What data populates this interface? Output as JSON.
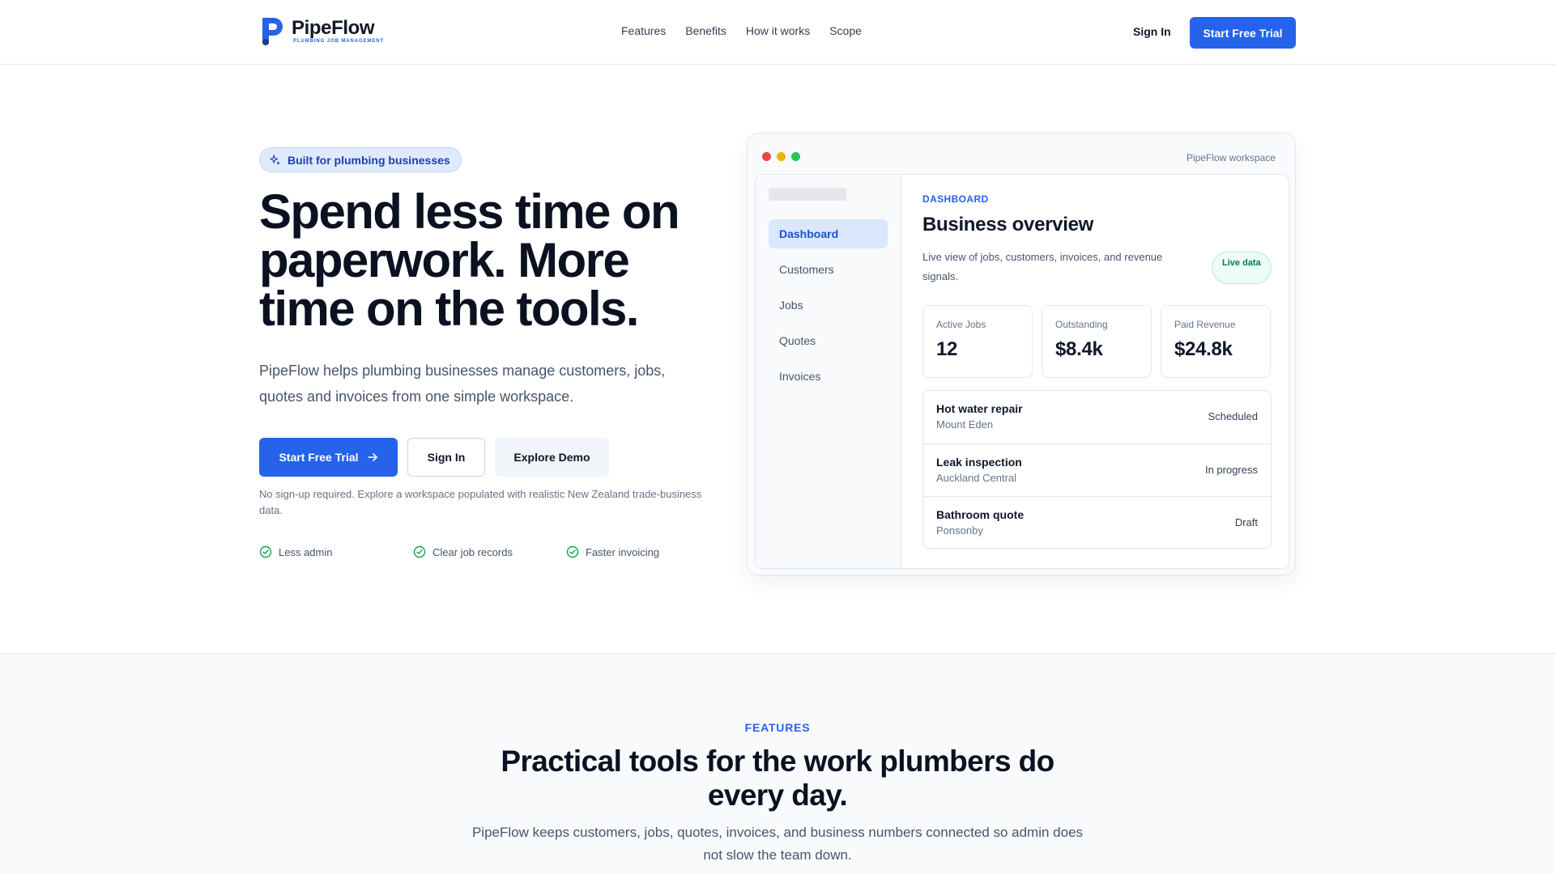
{
  "brand": {
    "name": "PipeFlow",
    "tagline": "PLUMBING JOB MANAGEMENT",
    "accent": "#2563eb"
  },
  "nav": [
    "Features",
    "Benefits",
    "How it works",
    "Scope"
  ],
  "header": {
    "signin_label": "Sign In",
    "trial_label": "Start Free Trial"
  },
  "hero": {
    "badge": "Built for plumbing businesses",
    "title": "Spend less time on paperwork. More time on the tools.",
    "subtitle": "PipeFlow helps plumbing businesses manage customers, jobs, quotes and invoices from one simple workspace.",
    "primary_cta": "Start Free Trial",
    "secondary_cta": "Sign In",
    "tertiary_cta": "Explore Demo",
    "hint": "No sign-up required. Explore a workspace populated with realistic New Zealand trade-business data.",
    "checks": [
      "Less admin",
      "Clear job records",
      "Faster invoicing"
    ]
  },
  "mockup": {
    "window_title": "PipeFlow workspace",
    "sidebar": [
      "Dashboard",
      "Customers",
      "Jobs",
      "Quotes",
      "Invoices"
    ],
    "active_item": "Dashboard",
    "section_label": "DASHBOARD",
    "title": "Business overview",
    "description": "Live view of jobs, customers, invoices, and revenue signals.",
    "live_badge": "Live data",
    "stats": [
      {
        "label": "Active Jobs",
        "value": "12"
      },
      {
        "label": "Outstanding",
        "value": "$8.4k"
      },
      {
        "label": "Paid Revenue",
        "value": "$24.8k"
      }
    ],
    "jobs": [
      {
        "name": "Hot water repair",
        "location": "Mount Eden",
        "status": "Scheduled"
      },
      {
        "name": "Leak inspection",
        "location": "Auckland Central",
        "status": "In progress"
      },
      {
        "name": "Bathroom quote",
        "location": "Ponsonby",
        "status": "Draft"
      }
    ]
  },
  "features": {
    "label": "FEATURES",
    "title": "Practical tools for the work plumbers do every day.",
    "subtitle": "PipeFlow keeps customers, jobs, quotes, invoices, and business numbers connected so admin does not slow the team down."
  }
}
